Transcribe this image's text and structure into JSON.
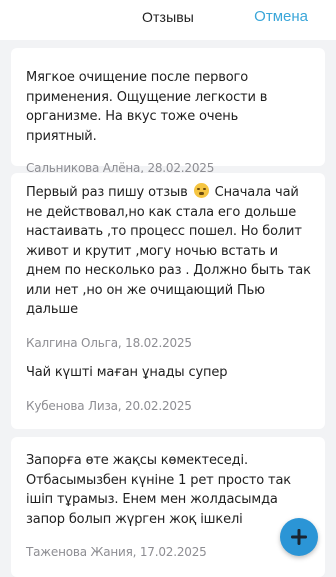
{
  "header": {
    "title": "Отзывы",
    "cancel_label": "Отмена"
  },
  "reviews": [
    {
      "text": "Мягкое очищение после первого применения. Ощущение легкости в организме. На вкус тоже очень приятный.",
      "author_date": "Сальникова Алёна, 28.02.2025"
    },
    {
      "text_before_emoji": "Первый раз пишу отзыв",
      "text_after_emoji": " Сначала чай не действовал,но как стала его дольше настаивать ,то процесс пошел. Но болит живот и крутит ,могу ночью встать и днем по несколько раз . Должно быть так или нет ,но он же очищающий  Пью дальше",
      "author_date": "Калгина Ольга, 18.02.2025"
    },
    {
      "text": "Чай күшті маған ұнады супер",
      "author_date": "Кубенова Лиза, 20.02.2025"
    },
    {
      "text": "Запорға  өте жақсы көмектеседі. Отбасымызбен күніне 1 рет просто так ішіп тұрамыз. Енем мен жолдасымда запор болып жүрген жоқ ішкелі",
      "author_date": "Таженова Жания, 17.02.2025"
    }
  ],
  "icons": {
    "emoji": "embarrassed-face-icon",
    "fab": "plus-icon"
  },
  "colors": {
    "accent": "#3aa6d9",
    "fab": "#2b95d6",
    "background": "#f2f3f5"
  }
}
